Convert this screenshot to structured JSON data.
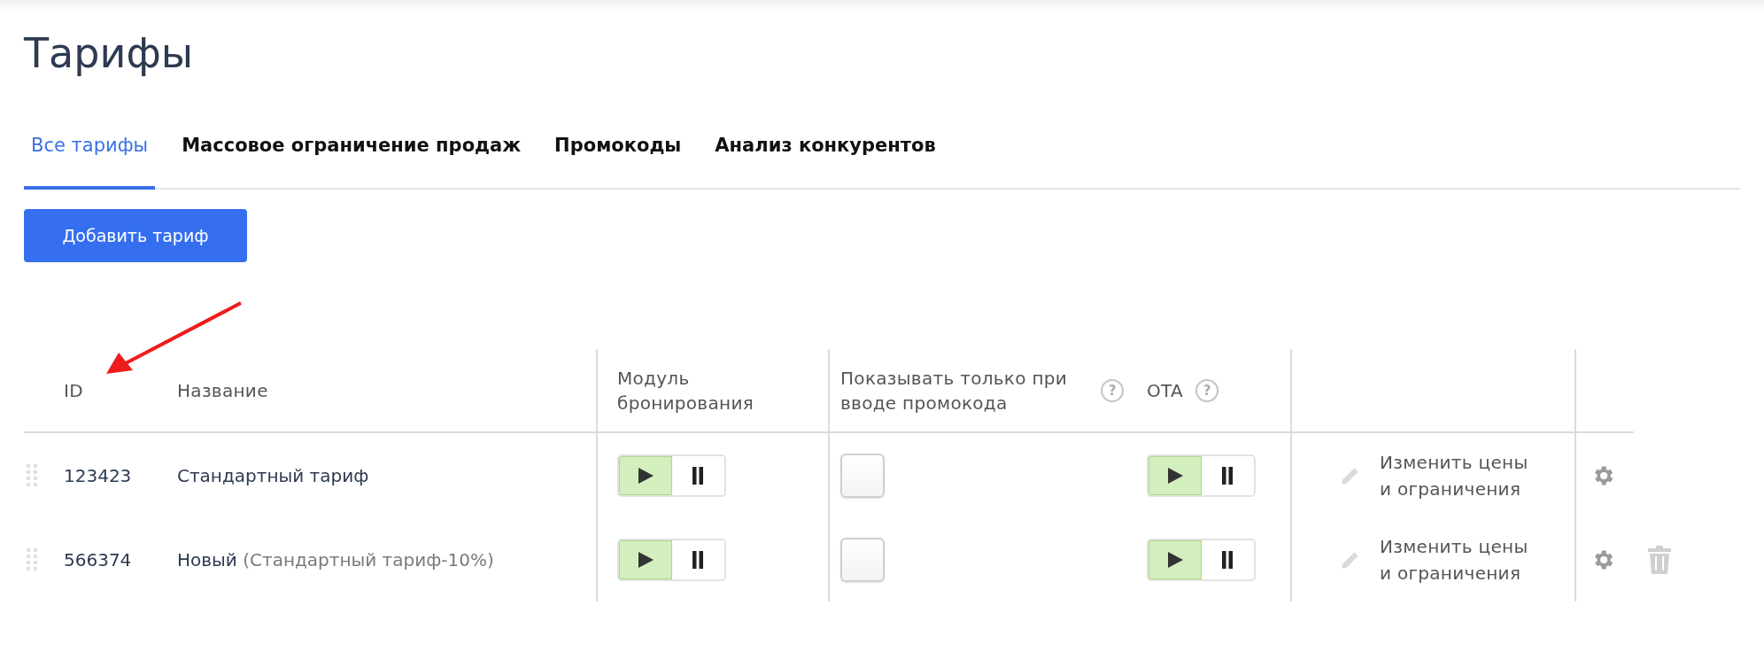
{
  "page": {
    "title": "Тарифы"
  },
  "tabs": [
    {
      "label": "Все тарифы",
      "selected": true
    },
    {
      "label": "Массовое ограничение продаж",
      "selected": false
    },
    {
      "label": "Промокоды",
      "selected": false
    },
    {
      "label": "Анализ конкурентов",
      "selected": false
    }
  ],
  "add_button": "Добавить тариф",
  "table": {
    "columns": [
      {
        "label": "ID"
      },
      {
        "label": "Название"
      },
      {
        "label": "Модуль бронирования"
      },
      {
        "label": "Показывать только при вводе промокода",
        "help": "?"
      },
      {
        "label": "OTA",
        "help": "?"
      }
    ],
    "rows": [
      {
        "id": "123423",
        "name": "Стандартный тариф",
        "note": "",
        "booking_running": true,
        "promo_only": false,
        "ota_running": true,
        "action": "Изменить цены и ограничения",
        "deletable": false
      },
      {
        "id": "566374",
        "name": "Новый",
        "note": "(Стандартный тариф-10%)",
        "booking_running": true,
        "promo_only": false,
        "ota_running": true,
        "action": "Изменить цены и ограничения",
        "deletable": true
      }
    ]
  }
}
